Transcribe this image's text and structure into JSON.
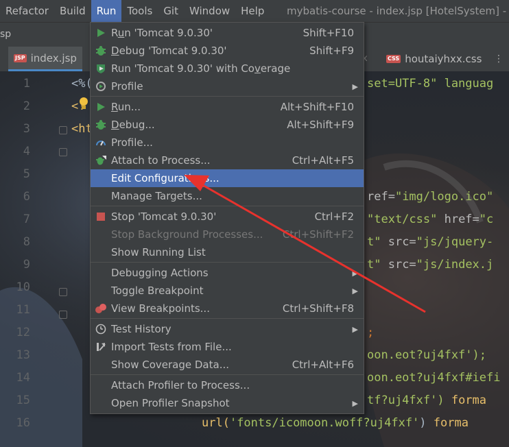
{
  "menubar": {
    "items": [
      "Refactor",
      "Build",
      "Run",
      "Tools",
      "Git",
      "Window",
      "Help"
    ],
    "active": "Run",
    "window_title": "mybatis-course - index.jsp [HotelSystem] - A"
  },
  "project": {
    "label": "sp"
  },
  "tabs": {
    "active": {
      "name": "index.jsp",
      "badge": "JSP"
    },
    "fragment": "x",
    "other": {
      "name": "houtaiyhxx.css",
      "badge": "CSS"
    },
    "more": "⋮"
  },
  "editor": {
    "line_numbers": [
      "1",
      "2",
      "3",
      "4",
      "5",
      "6",
      "7",
      "8",
      "9",
      "10",
      "11",
      "12",
      "13",
      "14",
      "15",
      "16"
    ],
    "lines": {
      "l1a": "<%(",
      "l1b": "set=UTF-8\" languag",
      "l2": "<!",
      "l3": "<ht",
      "l6a": "ref=",
      "l6b": "\"img/logo.ico\"",
      "l7a": "\"text/css\" ",
      "l7b": "href=",
      "l7c": "\"c",
      "l8a": "t\" ",
      "l8b": "src=",
      "l8c": "\"js/jquery-",
      "l9a": "t\" ",
      "l9b": "src=",
      "l9c": "\"js/index.j",
      "l12": ";",
      "l13": "oon.eot?uj4fxf');",
      "l14": "oon.eot?uj4fxf#iefi",
      "l15a": "tf?uj4fxf') ",
      "l15b": "forma",
      "l16a": "url(",
      "l16b": "'fonts/icomoon.woff?uj4fxf'",
      "l16c": ") ",
      "l16d": "forma"
    }
  },
  "run_menu": {
    "items": [
      {
        "label_pre": "R",
        "label_ul": "u",
        "label_post": "n 'Tomcat 9.0.30'",
        "shortcut": "Shift+F10",
        "icon": "run-icon"
      },
      {
        "label_pre": "",
        "label_ul": "D",
        "label_post": "ebug 'Tomcat 9.0.30'",
        "shortcut": "Shift+F9",
        "icon": "debug-icon"
      },
      {
        "label_pre": "Run 'Tomcat 9.0.30' with Co",
        "label_ul": "v",
        "label_post": "erage",
        "shortcut": "",
        "icon": "coverage-icon"
      },
      {
        "label_pre": "Profile",
        "label_ul": "",
        "label_post": "",
        "shortcut": "",
        "icon": "profile-icon",
        "submenu": true
      },
      {
        "label_pre": "",
        "label_ul": "R",
        "label_post": "un...",
        "shortcut": "Alt+Shift+F10",
        "icon": "run-icon"
      },
      {
        "label_pre": "",
        "label_ul": "D",
        "label_post": "ebug...",
        "shortcut": "Alt+Shift+F9",
        "icon": "debug-icon"
      },
      {
        "label_pre": "Profile...",
        "label_ul": "",
        "label_post": "",
        "shortcut": "",
        "icon": "profiler-gauge-icon"
      },
      {
        "label_pre": "Attach to Process...",
        "label_ul": "",
        "label_post": "",
        "shortcut": "Ctrl+Alt+F5",
        "icon": "attach-debugger-icon"
      },
      {
        "label_pre": "Edit Configurations...",
        "label_ul": "",
        "label_post": "",
        "shortcut": "",
        "icon": ""
      },
      {
        "label_pre": "Manage Targets...",
        "label_ul": "",
        "label_post": "",
        "shortcut": "",
        "icon": ""
      },
      {
        "label_pre": "Stop 'Tomcat 9.0.30'",
        "label_ul": "",
        "label_post": "",
        "shortcut": "Ctrl+F2",
        "icon": "stop-icon"
      },
      {
        "label_pre": "Stop Background Processes...",
        "label_ul": "",
        "label_post": "",
        "shortcut": "Ctrl+Shift+F2",
        "icon": ""
      },
      {
        "label_pre": "Show Running List",
        "label_ul": "",
        "label_post": "",
        "shortcut": "",
        "icon": ""
      },
      {
        "label_pre": "Debugging Actions",
        "label_ul": "",
        "label_post": "",
        "shortcut": "",
        "icon": "",
        "submenu": true
      },
      {
        "label_pre": "Toggle Breakpoint",
        "label_ul": "",
        "label_post": "",
        "shortcut": "",
        "icon": "",
        "submenu": true
      },
      {
        "label_pre": "View Breakpoints...",
        "label_ul": "",
        "label_post": "",
        "shortcut": "Ctrl+Shift+F8",
        "icon": "breakpoints-icon"
      },
      {
        "label_pre": "Test History",
        "label_ul": "",
        "label_post": "",
        "shortcut": "",
        "icon": "clock-icon",
        "submenu": true
      },
      {
        "label_pre": "Import Tests from File...",
        "label_ul": "",
        "label_post": "",
        "shortcut": "",
        "icon": "import-icon"
      },
      {
        "label_pre": "Show Coverage Data...",
        "label_ul": "",
        "label_post": "",
        "shortcut": "Ctrl+Alt+F6",
        "icon": ""
      },
      {
        "label_pre": "Attach Profiler to Process...",
        "label_ul": "",
        "label_post": "",
        "shortcut": "",
        "icon": ""
      },
      {
        "label_pre": "Open Profiler Snapshot",
        "label_ul": "",
        "label_post": "",
        "shortcut": "",
        "icon": "",
        "submenu": true
      }
    ],
    "selected_index": 8,
    "disabled_index": 11,
    "submenu_glyph": "▶"
  },
  "colors": {
    "accent": "#4b6eaf",
    "run_green": "#499c54",
    "stop_red": "#c75450",
    "annotation_red": "#e8322d"
  }
}
